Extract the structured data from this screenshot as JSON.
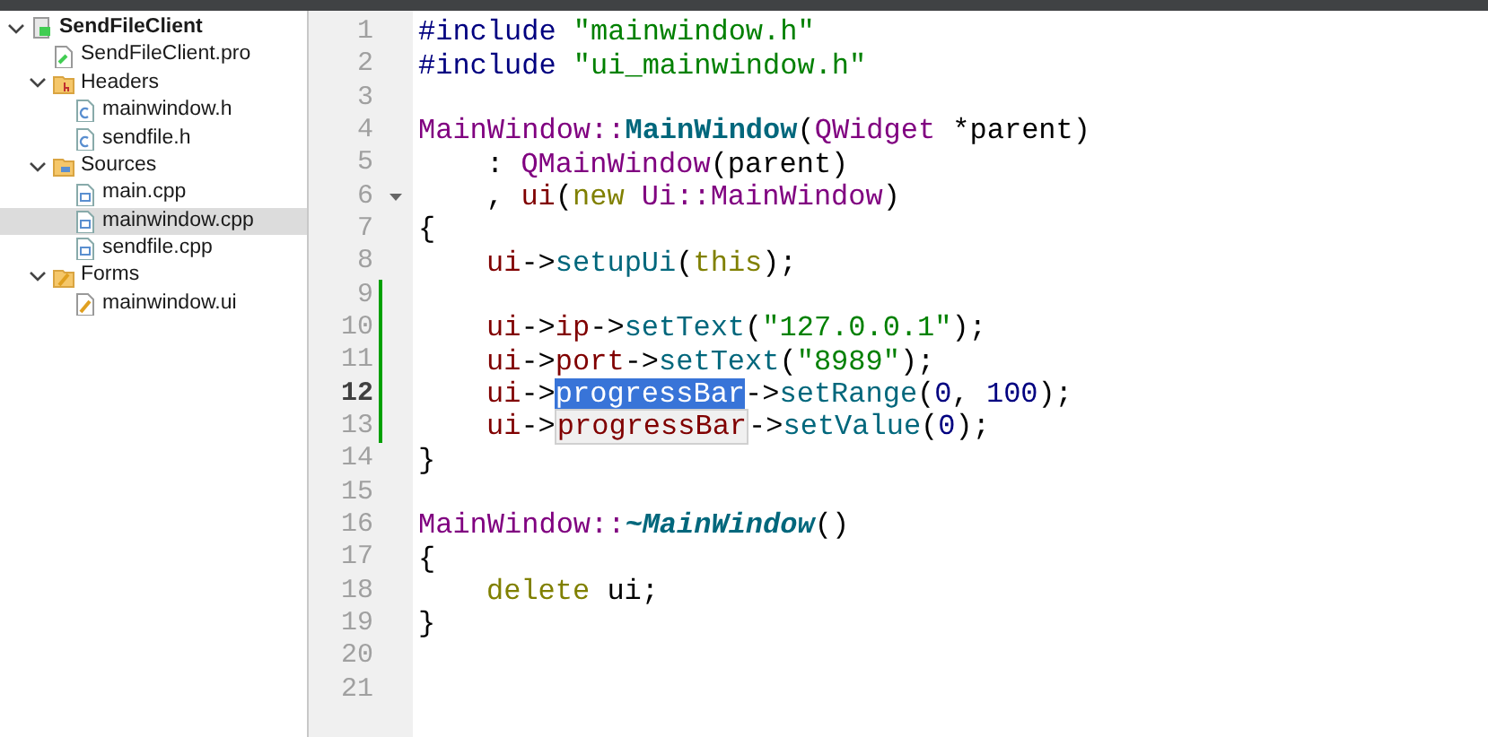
{
  "project_tree": [
    {
      "label": "SendFileClient",
      "kind": "project",
      "expanded": true,
      "selected": false,
      "children": [
        {
          "label": "SendFileClient.pro",
          "kind": "pro",
          "selected": false
        },
        {
          "label": "Headers",
          "kind": "headers",
          "expanded": true,
          "selected": false,
          "children": [
            {
              "label": "mainwindow.h",
              "kind": "header",
              "selected": false
            },
            {
              "label": "sendfile.h",
              "kind": "header",
              "selected": false
            }
          ]
        },
        {
          "label": "Sources",
          "kind": "sources",
          "expanded": true,
          "selected": false,
          "children": [
            {
              "label": "main.cpp",
              "kind": "source",
              "selected": false
            },
            {
              "label": "mainwindow.cpp",
              "kind": "source",
              "selected": true
            },
            {
              "label": "sendfile.cpp",
              "kind": "source",
              "selected": false
            }
          ]
        },
        {
          "label": "Forms",
          "kind": "forms",
          "expanded": true,
          "selected": false,
          "children": [
            {
              "label": "mainwindow.ui",
              "kind": "form",
              "selected": false
            }
          ]
        }
      ]
    }
  ],
  "editor_lines": [
    {
      "number": "1",
      "changed": false,
      "current": false,
      "foldable": false,
      "indented": false,
      "tokens": [
        {
          "text": "#include",
          "kind": "preproc"
        },
        {
          "text": "\"mainwindow.h\"",
          "kind": "string"
        }
      ]
    },
    {
      "number": "2",
      "changed": false,
      "current": false,
      "foldable": false,
      "indented": false,
      "tokens": [
        {
          "text": "#include",
          "kind": "preproc"
        },
        {
          "text": "\"ui_mainwindow.h\"",
          "kind": "string"
        }
      ]
    },
    {
      "number": "3",
      "changed": false,
      "current": false,
      "foldable": false
    },
    {
      "number": "4",
      "changed": false,
      "current": false,
      "foldable": false,
      "indented": false,
      "tokens": [
        {
          "text": "MainWindow::",
          "kind": "class"
        },
        {
          "text": "MainWindow",
          "kind": "definition"
        },
        {
          "text": "(",
          "kind": "plain"
        },
        {
          "text": "QWidget",
          "kind": "class"
        },
        {
          "text": "*parent)",
          "kind": "plain"
        }
      ]
    },
    {
      "number": "5",
      "changed": false,
      "current": false,
      "foldable": false,
      "indented": true,
      "tokens": [
        {
          "text": ":",
          "kind": "plain"
        },
        {
          "text": "QMainWindow",
          "kind": "class"
        },
        {
          "text": "(parent)",
          "kind": "plain"
        }
      ]
    },
    {
      "number": "6",
      "changed": false,
      "current": false,
      "foldable": true,
      "indented": true,
      "tokens": [
        {
          "text": ",",
          "kind": "plain"
        },
        {
          "text": "ui",
          "kind": "member",
          "selected": false,
          "highlighted": false
        },
        {
          "text": "(",
          "kind": "plain"
        },
        {
          "text": "new",
          "kind": "keyword"
        },
        {
          "text": "Ui::MainWindow",
          "kind": "class"
        },
        {
          "text": ")",
          "kind": "plain"
        }
      ]
    },
    {
      "number": "7",
      "changed": false,
      "current": false,
      "foldable": false,
      "indented": false,
      "tokens": [
        {
          "text": "{",
          "kind": "plain"
        }
      ]
    },
    {
      "number": "8",
      "changed": false,
      "current": false,
      "foldable": false,
      "indented": true,
      "tokens": [
        {
          "text": "ui",
          "kind": "member",
          "selected": false,
          "highlighted": false
        },
        {
          "text": "->",
          "kind": "plain"
        },
        {
          "text": "setupUi",
          "kind": "function"
        },
        {
          "text": "(",
          "kind": "plain"
        },
        {
          "text": "this",
          "kind": "keyword"
        },
        {
          "text": ");",
          "kind": "plain"
        }
      ]
    },
    {
      "number": "9",
      "changed": true,
      "current": false,
      "foldable": false
    },
    {
      "number": "10",
      "changed": true,
      "current": false,
      "foldable": false,
      "indented": true,
      "tokens": [
        {
          "text": "ui",
          "kind": "member",
          "selected": false,
          "highlighted": false
        },
        {
          "text": "->",
          "kind": "plain"
        },
        {
          "text": "ip",
          "kind": "member",
          "selected": false,
          "highlighted": false
        },
        {
          "text": "->",
          "kind": "plain"
        },
        {
          "text": "setText",
          "kind": "function"
        },
        {
          "text": "(",
          "kind": "plain"
        },
        {
          "text": "\"127.0.0.1\"",
          "kind": "string"
        },
        {
          "text": ");",
          "kind": "plain"
        }
      ]
    },
    {
      "number": "11",
      "changed": true,
      "current": false,
      "foldable": false,
      "indented": true,
      "tokens": [
        {
          "text": "ui",
          "kind": "member",
          "selected": false,
          "highlighted": false
        },
        {
          "text": "->",
          "kind": "plain"
        },
        {
          "text": "port",
          "kind": "member",
          "selected": false,
          "highlighted": false
        },
        {
          "text": "->",
          "kind": "plain"
        },
        {
          "text": "setText",
          "kind": "function"
        },
        {
          "text": "(",
          "kind": "plain"
        },
        {
          "text": "\"8989\"",
          "kind": "string"
        },
        {
          "text": ");",
          "kind": "plain"
        }
      ]
    },
    {
      "number": "12",
      "changed": true,
      "current": true,
      "foldable": false,
      "indented": true,
      "tokens": [
        {
          "text": "ui",
          "kind": "member",
          "selected": false,
          "highlighted": false
        },
        {
          "text": "->",
          "kind": "plain"
        },
        {
          "text": "progressBar",
          "kind": "member",
          "selected": true,
          "highlighted": false
        },
        {
          "text": "->",
          "kind": "plain"
        },
        {
          "text": "setRange",
          "kind": "function"
        },
        {
          "text": "(",
          "kind": "plain"
        },
        {
          "text": "0",
          "kind": "number"
        },
        {
          "text": ",",
          "kind": "plain"
        },
        {
          "text": "100",
          "kind": "number"
        },
        {
          "text": ");",
          "kind": "plain"
        }
      ]
    },
    {
      "number": "13",
      "changed": true,
      "current": false,
      "foldable": false,
      "indented": true,
      "tokens": [
        {
          "text": "ui",
          "kind": "member",
          "selected": false,
          "highlighted": false
        },
        {
          "text": "->",
          "kind": "plain"
        },
        {
          "text": "progressBar",
          "kind": "member",
          "selected": false,
          "highlighted": true
        },
        {
          "text": "->",
          "kind": "plain"
        },
        {
          "text": "setValue",
          "kind": "function"
        },
        {
          "text": "(",
          "kind": "plain"
        },
        {
          "text": "0",
          "kind": "number"
        },
        {
          "text": ");",
          "kind": "plain"
        }
      ]
    },
    {
      "number": "14",
      "changed": false,
      "current": false,
      "foldable": false,
      "indented": false,
      "tokens": [
        {
          "text": "}",
          "kind": "plain"
        }
      ]
    },
    {
      "number": "15",
      "changed": false,
      "current": false,
      "foldable": false
    },
    {
      "number": "16",
      "changed": false,
      "current": false,
      "foldable": false,
      "indented": false,
      "tokens": [
        {
          "text": "MainWindow::",
          "kind": "class"
        },
        {
          "text": "~MainWindow",
          "kind": "destructor"
        },
        {
          "text": "()",
          "kind": "plain"
        }
      ]
    },
    {
      "number": "17",
      "changed": false,
      "current": false,
      "foldable": false,
      "indented": false,
      "tokens": [
        {
          "text": "{",
          "kind": "plain"
        }
      ]
    },
    {
      "number": "18",
      "changed": false,
      "current": false,
      "foldable": false,
      "indented": true,
      "tokens": [
        {
          "text": "delete",
          "kind": "keyword"
        },
        {
          "text": "ui;",
          "kind": "plain"
        }
      ]
    },
    {
      "number": "19",
      "changed": false,
      "current": false,
      "foldable": false,
      "indented": false,
      "tokens": [
        {
          "text": "}",
          "kind": "plain"
        }
      ]
    },
    {
      "number": "20",
      "changed": false,
      "current": false,
      "foldable": false
    },
    {
      "number": "21",
      "changed": false,
      "current": false,
      "foldable": false
    }
  ]
}
